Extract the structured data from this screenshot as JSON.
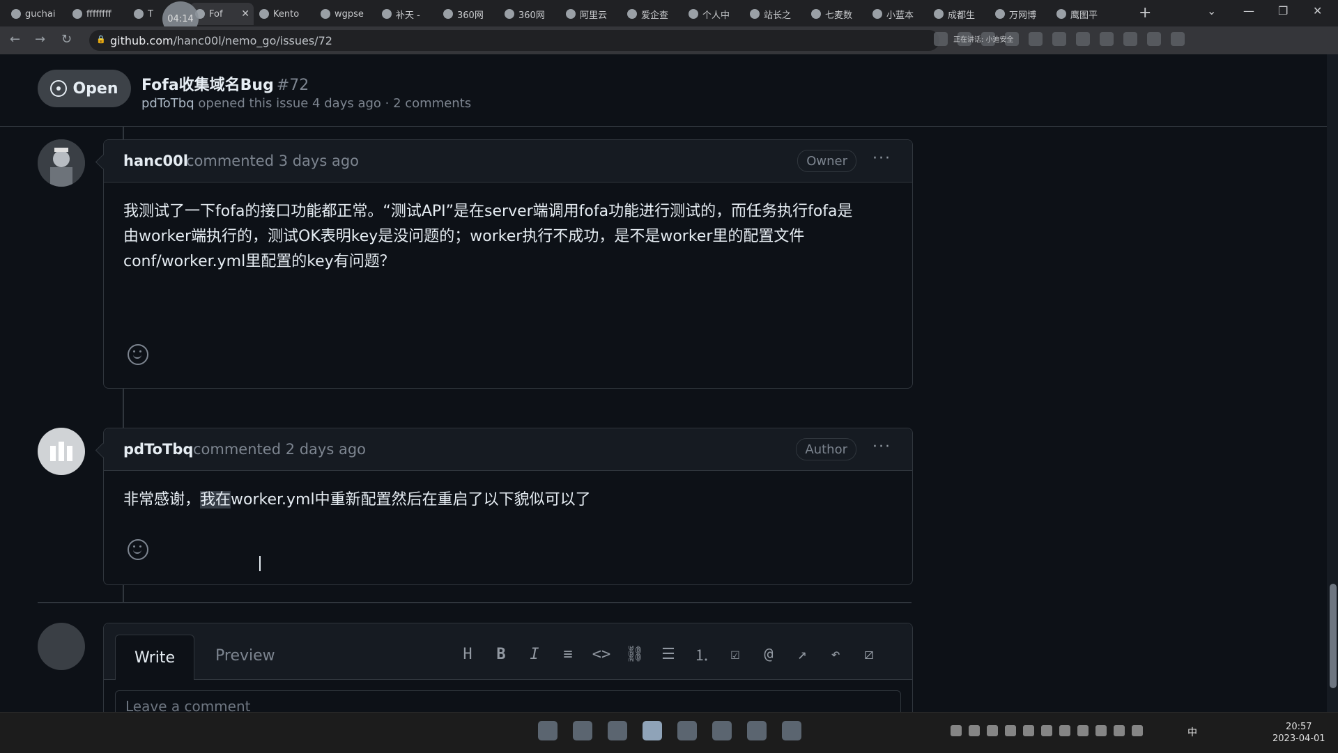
{
  "browser": {
    "tabs": [
      {
        "label": "guchai"
      },
      {
        "label": "ffffffff"
      },
      {
        "label": "T"
      },
      {
        "label": "Fof",
        "active": true
      },
      {
        "label": "Kento"
      },
      {
        "label": "wgpse"
      },
      {
        "label": "补天 -"
      },
      {
        "label": "360网"
      },
      {
        "label": "360网"
      },
      {
        "label": "阿里云"
      },
      {
        "label": "爱企查"
      },
      {
        "label": "个人中"
      },
      {
        "label": "站长之"
      },
      {
        "label": "七麦数"
      },
      {
        "label": "小蓝本"
      },
      {
        "label": "成都生"
      },
      {
        "label": "万网博"
      },
      {
        "label": "鹰图平"
      }
    ],
    "recording_badge": "04:14",
    "url_host": "github.com",
    "url_path": "/hanc00l/nemo_go/issues/72",
    "meeting_text": "正在讲话: 小迪安全"
  },
  "issue": {
    "status": "Open",
    "title": "Fofa收集域名Bug",
    "number": "#72",
    "author": "pdToTbq",
    "opened_text": "opened this issue 4 days ago · 2 comments"
  },
  "comments": [
    {
      "author": "hanc00l",
      "time": "commented 3 days ago",
      "role": "Owner",
      "body_lines": [
        "我测试了一下fofa的接口功能都正常。“测试API”是在server端调用fofa功能进行测试的，而任务执行fofa是",
        "由worker端执行的，测试OK表明key是没问题的；worker执行不成功，是不是worker里的配置文件",
        "conf/worker.yml里配置的key有问题？"
      ]
    },
    {
      "author": "pdToTbq",
      "time": "commented 2 days ago",
      "role": "Author",
      "body_before": "非常感谢，",
      "body_highlight": "我在",
      "body_after": "worker.yml中重新配置然后在重启了以下貌似可以了"
    }
  ],
  "editor": {
    "tab_write": "Write",
    "tab_preview": "Preview",
    "placeholder": "Leave a comment"
  },
  "taskbar": {
    "ime": "中",
    "time": "20:57",
    "date": "2023-04-01"
  }
}
